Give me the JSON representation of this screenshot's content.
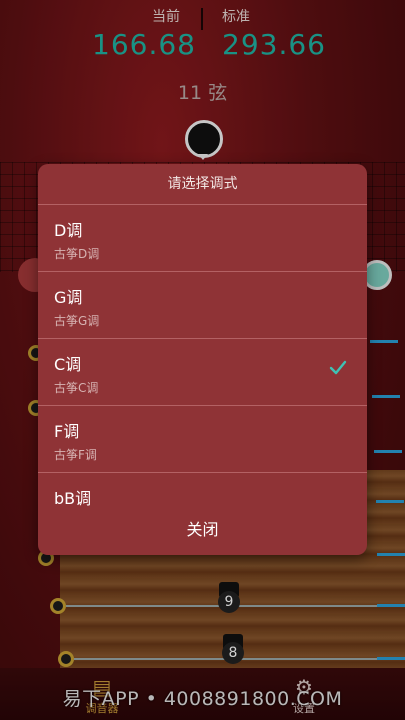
{
  "tuner": {
    "current_label": "当前",
    "standard_label": "标准",
    "current_freq": "166.68",
    "standard_freq": "293.66",
    "string_label": "11 弦"
  },
  "string_numbers": [
    "9",
    "8"
  ],
  "dialog": {
    "title": "请选择调式",
    "options": [
      {
        "name": "D调",
        "sub": "古筝D调",
        "selected": false
      },
      {
        "name": "G调",
        "sub": "古筝G调",
        "selected": false
      },
      {
        "name": "C调",
        "sub": "古筝C调",
        "selected": true
      },
      {
        "name": "F调",
        "sub": "古筝F调",
        "selected": false
      },
      {
        "name": "bB调",
        "sub": "",
        "selected": false
      }
    ],
    "close_label": "关闭"
  },
  "tabbar": {
    "tuner_label": "调音器",
    "settings_label": "设置",
    "tuner_icon": "tuner-icon",
    "settings_icon": "gear-icon"
  },
  "watermark": "易下APP • 4008891800.COM",
  "colors": {
    "accent_freq": "#1fb3a3",
    "dialog_bg": "#8f3336",
    "check": "#3fc1b4",
    "tab_active": "#c99a3a"
  }
}
